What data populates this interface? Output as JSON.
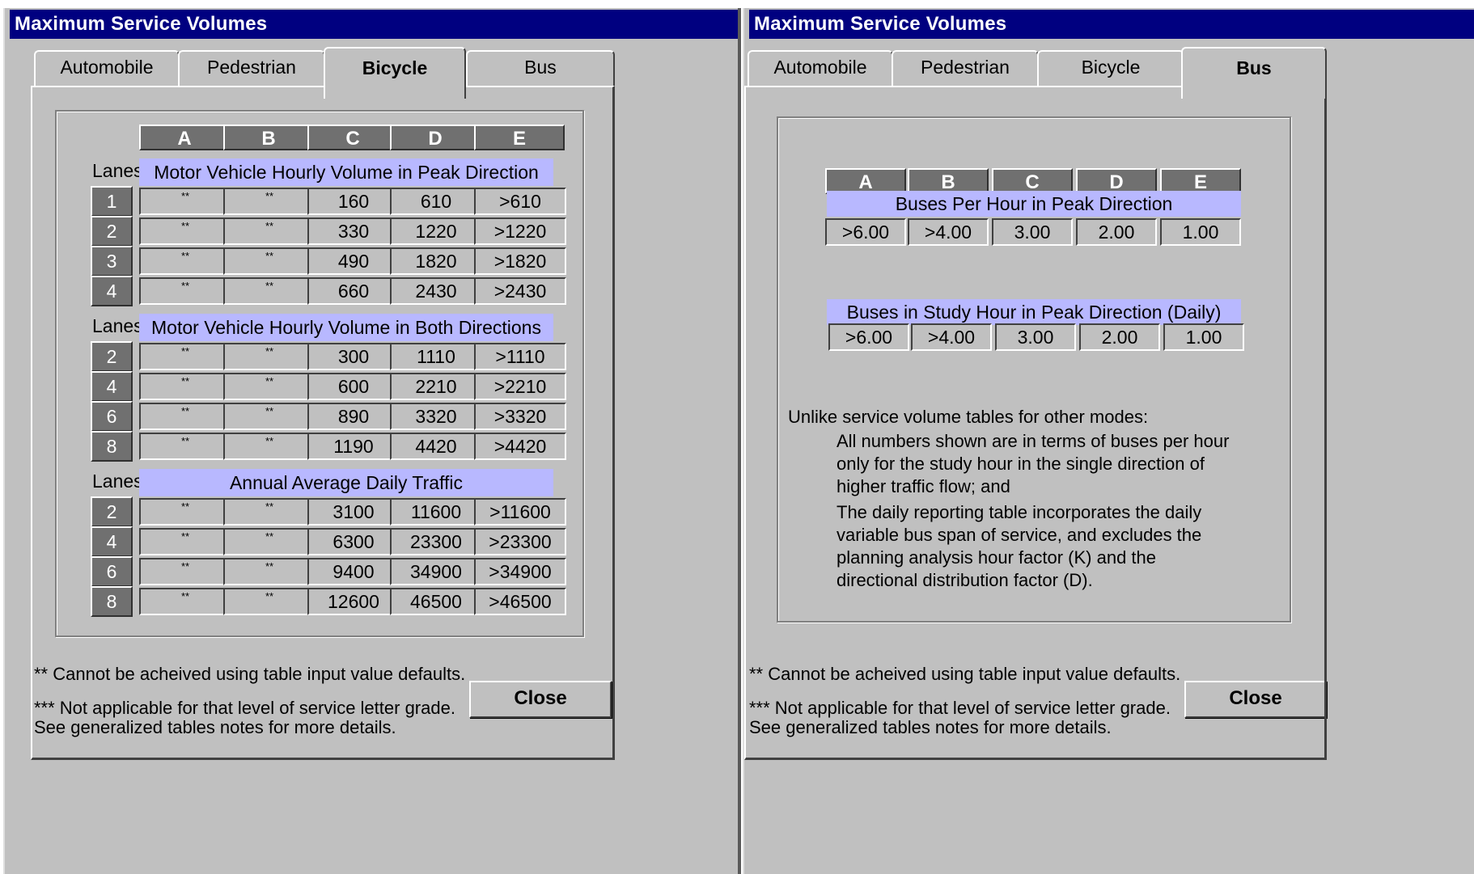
{
  "left": {
    "title": "Maximum Service Volumes",
    "tabs": [
      "Automobile",
      "Pedestrian",
      "Bicycle",
      "Bus"
    ],
    "active_tab": "Bicycle",
    "headers": [
      "A",
      "B",
      "C",
      "D",
      "E"
    ],
    "lanes_label": "Lanes",
    "sections": [
      {
        "title": "Motor Vehicle Hourly Volume in Peak Direction",
        "rows": [
          {
            "lane": "1",
            "values": [
              "**",
              "**",
              "160",
              "610",
              ">610"
            ]
          },
          {
            "lane": "2",
            "values": [
              "**",
              "**",
              "330",
              "1220",
              ">1220"
            ]
          },
          {
            "lane": "3",
            "values": [
              "**",
              "**",
              "490",
              "1820",
              ">1820"
            ]
          },
          {
            "lane": "4",
            "values": [
              "**",
              "**",
              "660",
              "2430",
              ">2430"
            ]
          }
        ]
      },
      {
        "title": "Motor Vehicle Hourly Volume in Both Directions",
        "rows": [
          {
            "lane": "2",
            "values": [
              "**",
              "**",
              "300",
              "1110",
              ">1110"
            ]
          },
          {
            "lane": "4",
            "values": [
              "**",
              "**",
              "600",
              "2210",
              ">2210"
            ]
          },
          {
            "lane": "6",
            "values": [
              "**",
              "**",
              "890",
              "3320",
              ">3320"
            ]
          },
          {
            "lane": "8",
            "values": [
              "**",
              "**",
              "1190",
              "4420",
              ">4420"
            ]
          }
        ]
      },
      {
        "title": "Annual Average Daily Traffic",
        "rows": [
          {
            "lane": "2",
            "values": [
              "**",
              "**",
              "3100",
              "11600",
              ">11600"
            ]
          },
          {
            "lane": "4",
            "values": [
              "**",
              "**",
              "6300",
              "23300",
              ">23300"
            ]
          },
          {
            "lane": "6",
            "values": [
              "**",
              "**",
              "9400",
              "34900",
              ">34900"
            ]
          },
          {
            "lane": "8",
            "values": [
              "**",
              "**",
              "12600",
              "46500",
              ">46500"
            ]
          }
        ]
      }
    ],
    "note1": "** Cannot be acheived using table input value defaults.",
    "note2": "*** Not applicable for that level of service letter grade.",
    "note3": "See generalized tables notes for more details.",
    "close_label": "Close"
  },
  "right": {
    "title": "Maximum Service Volumes",
    "tabs": [
      "Automobile",
      "Pedestrian",
      "Bicycle",
      "Bus"
    ],
    "active_tab": "Bus",
    "headers": [
      "A",
      "B",
      "C",
      "D",
      "E"
    ],
    "section1_title": "Buses Per Hour in Peak Direction",
    "section1_values": [
      ">6.00",
      ">4.00",
      "3.00",
      "2.00",
      "1.00"
    ],
    "section2_title": "Buses in Study Hour in Peak Direction (Daily)",
    "section2_values": [
      ">6.00",
      ">4.00",
      "3.00",
      "2.00",
      "1.00"
    ],
    "intro": "Unlike service volume tables for other modes:",
    "para1_lines": [
      "All numbers shown are in terms of buses per hour",
      "only for the study hour in the single direction of",
      "higher traffic flow; and"
    ],
    "para2_lines": [
      "The daily reporting table incorporates the daily",
      "variable bus span of service, and excludes the",
      "planning analysis hour factor (K) and the",
      "directional distribution factor (D)."
    ],
    "note1": "** Cannot be acheived using table input value defaults.",
    "note2": "*** Not applicable for that level of service letter grade.",
    "note3": "See generalized tables notes for more details.",
    "close_label": "Close"
  }
}
